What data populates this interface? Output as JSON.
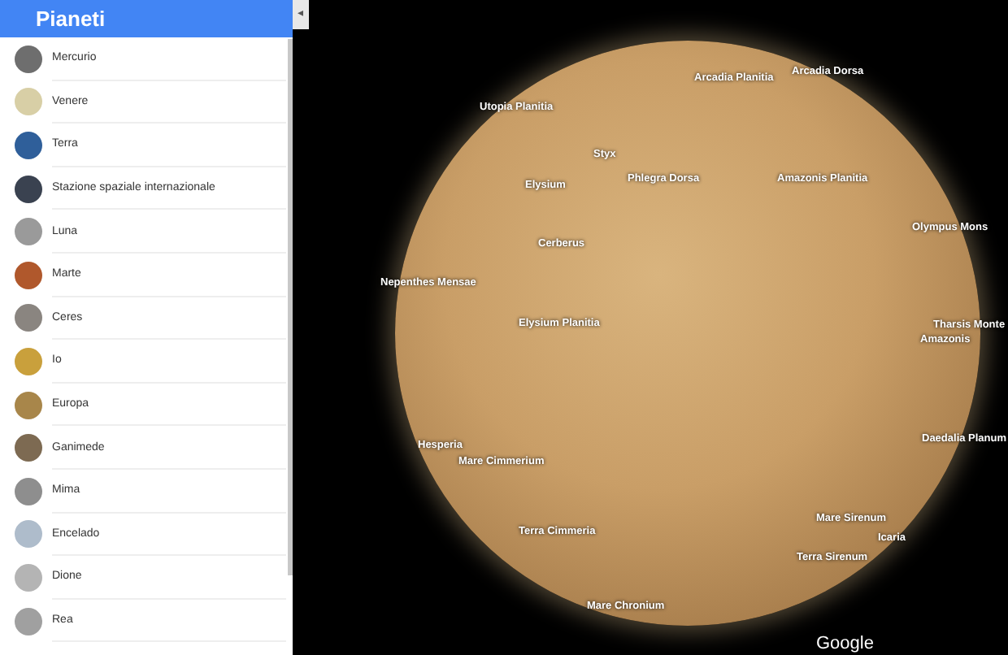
{
  "sidebar": {
    "title": "Pianeti",
    "collapse_icon": "◂",
    "items": [
      {
        "label": "Mercurio",
        "color": "#6e6e6e"
      },
      {
        "label": "Venere",
        "color": "#d8cfa6"
      },
      {
        "label": "Terra",
        "color": "#2f5f9a"
      },
      {
        "label": "Stazione spaziale internazionale",
        "color": "#3a4250"
      },
      {
        "label": "Luna",
        "color": "#9a9a9a"
      },
      {
        "label": "Marte",
        "color": "#b0582c"
      },
      {
        "label": "Ceres",
        "color": "#8a8580"
      },
      {
        "label": "Io",
        "color": "#c9a03c"
      },
      {
        "label": "Europa",
        "color": "#a8864a"
      },
      {
        "label": "Ganimede",
        "color": "#7d6a52"
      },
      {
        "label": "Mima",
        "color": "#8e8e8e"
      },
      {
        "label": "Encelado",
        "color": "#aebccb"
      },
      {
        "label": "Dione",
        "color": "#b4b4b4"
      },
      {
        "label": "Rea",
        "color": "#a0a0a0"
      }
    ]
  },
  "map": {
    "labels": [
      "Arcadia Planitia",
      "Arcadia Dorsa",
      "Utopia Planitia",
      "Styx",
      "Phlegra Dorsa",
      "Elysium",
      "Amazonis Planitia",
      "Olympus Mons",
      "Cerberus",
      "Nepenthes Mensae",
      "Elysium Planitia",
      "Tharsis Monte",
      "Amazonis",
      "Daedalia Planum",
      "Hesperia",
      "Mare Cimmerium",
      "Terra Cimmeria",
      "Mare Sirenum",
      "Icaria",
      "Terra Sirenum",
      "Mare Chronium"
    ],
    "attribution": "Google"
  }
}
